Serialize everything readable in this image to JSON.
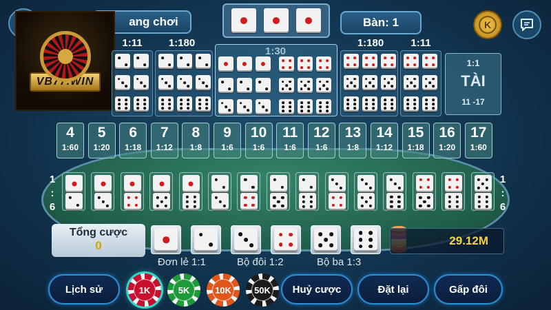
{
  "header": {
    "status_label": "ang chơi",
    "table_label": "Bàn: 1",
    "coin_letter": "K",
    "top_dice": [
      1,
      1,
      1
    ]
  },
  "logo": {
    "text": "VB77.WIN"
  },
  "ratios": {
    "specific_double_left": "1:11",
    "specific_triple_left": "1:180",
    "any_triple": "1:30",
    "specific_triple_right": "1:180",
    "specific_double_right": "1:11"
  },
  "tai": {
    "odds": "1:1",
    "label": "TÀI",
    "range": "11 -17"
  },
  "totals": [
    {
      "num": "4",
      "odd": "1:60"
    },
    {
      "num": "5",
      "odd": "1:20"
    },
    {
      "num": "6",
      "odd": "1:18"
    },
    {
      "num": "7",
      "odd": "1:12"
    },
    {
      "num": "8",
      "odd": "1:8"
    },
    {
      "num": "9",
      "odd": "1:6"
    },
    {
      "num": "10",
      "odd": "1:6"
    },
    {
      "num": "11",
      "odd": "1:6"
    },
    {
      "num": "12",
      "odd": "1:6"
    },
    {
      "num": "13",
      "odd": "1:8"
    },
    {
      "num": "14",
      "odd": "1:12"
    },
    {
      "num": "15",
      "odd": "1:18"
    },
    {
      "num": "16",
      "odd": "1:20"
    },
    {
      "num": "17",
      "odd": "1:60"
    }
  ],
  "pairs": [
    [
      1,
      2
    ],
    [
      1,
      3
    ],
    [
      1,
      4
    ],
    [
      1,
      5
    ],
    [
      1,
      6
    ],
    [
      2,
      3
    ],
    [
      2,
      4
    ],
    [
      2,
      5
    ],
    [
      2,
      6
    ],
    [
      3,
      4
    ],
    [
      3,
      5
    ],
    [
      3,
      6
    ],
    [
      4,
      5
    ],
    [
      4,
      6
    ],
    [
      5,
      6
    ]
  ],
  "pair_ratio": {
    "top": "1",
    "colon": ":",
    "bottom": "6"
  },
  "bet_total": {
    "label": "Tổng cược",
    "value": "0"
  },
  "singles": [
    1,
    2,
    3,
    4,
    5,
    6
  ],
  "balance": "29.12M",
  "captions": {
    "single": "Đơn lẻ 1:1",
    "double": "Bộ đôi 1:2",
    "triple": "Bộ ba 1:3"
  },
  "actions": {
    "history": "Lịch sử",
    "cancel": "Huỷ cược",
    "reset": "Đặt lại",
    "double": "Gấp đôi"
  },
  "chips": [
    {
      "label": "1K",
      "color": "#c8102e"
    },
    {
      "label": "5K",
      "color": "#1f9a3a"
    },
    {
      "label": "10K",
      "color": "#e0561b"
    },
    {
      "label": "50K",
      "color": "#1b1b1b"
    }
  ],
  "colors": {
    "accent_blue": "#2e8fd6",
    "balance_gold": "#f5d34a",
    "felt_green": "#2a7a60"
  }
}
